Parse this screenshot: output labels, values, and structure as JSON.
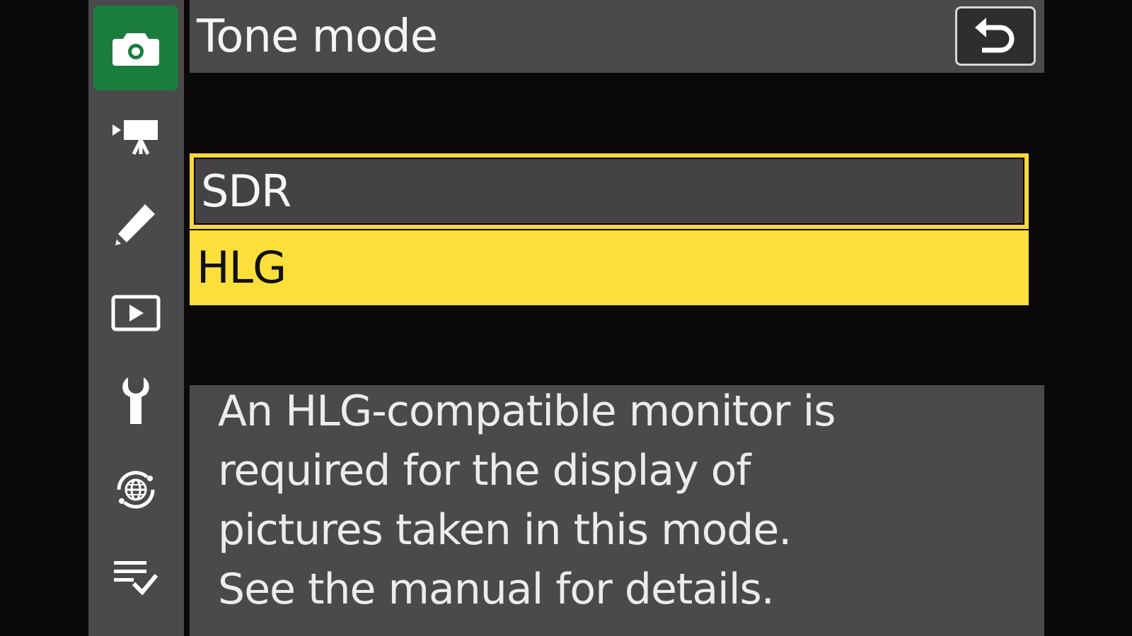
{
  "header": {
    "title": "Tone mode"
  },
  "sidebar": {
    "tabs": [
      {
        "icon": "camera-icon",
        "active": true
      },
      {
        "icon": "video-camera-icon",
        "active": false
      },
      {
        "icon": "pencil-icon",
        "active": false
      },
      {
        "icon": "playback-icon",
        "active": false
      },
      {
        "icon": "wrench-icon",
        "active": false
      },
      {
        "icon": "network-icon",
        "active": false
      },
      {
        "icon": "my-menu-icon",
        "active": false
      }
    ]
  },
  "options": [
    {
      "label": "SDR"
    },
    {
      "label": "HLG"
    }
  ],
  "description": {
    "lines": [
      "An HLG-compatible monitor is",
      "required for the display of",
      "pictures taken in this mode.",
      "See the manual for details."
    ]
  },
  "colors": {
    "active_tab": "#1a7d3c",
    "highlight": "#fddf3c",
    "panel": "#4a494b"
  }
}
